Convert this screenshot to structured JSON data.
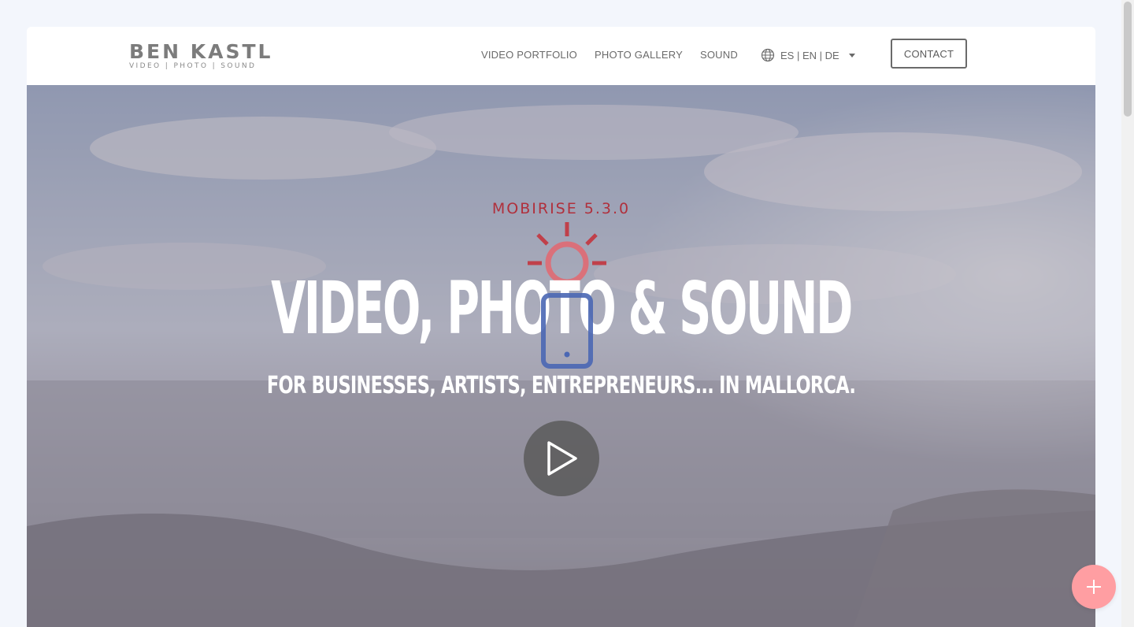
{
  "brand": {
    "title": "BEN KASTL",
    "subtitle": "VIDEO | PHOTO | SOUND"
  },
  "nav": {
    "items": [
      {
        "label": "VIDEO PORTFOLIO"
      },
      {
        "label": "PHOTO GALLERY"
      },
      {
        "label": "SOUND"
      }
    ],
    "language": {
      "label": "ES | EN | DE",
      "icon": "globe-icon"
    },
    "contact_label": "CONTACT"
  },
  "hero": {
    "version_label": "MOBIRISE  5.3.0",
    "title": "VIDEO, PHOTO & SOUND",
    "subtitle": "FOR BUSINESSES, ARTISTS, ENTREPRENEURS... IN MALLORCA.",
    "play_icon": "play-icon",
    "logo_icons": [
      "sun-icon",
      "tablet-icon"
    ]
  },
  "fab": {
    "icon": "plus-icon"
  },
  "colors": {
    "accent": "#ff9ea2",
    "version_text": "#b0303c",
    "tablet_icon": "#4a67b4",
    "nav_text": "#6a6a6a"
  }
}
